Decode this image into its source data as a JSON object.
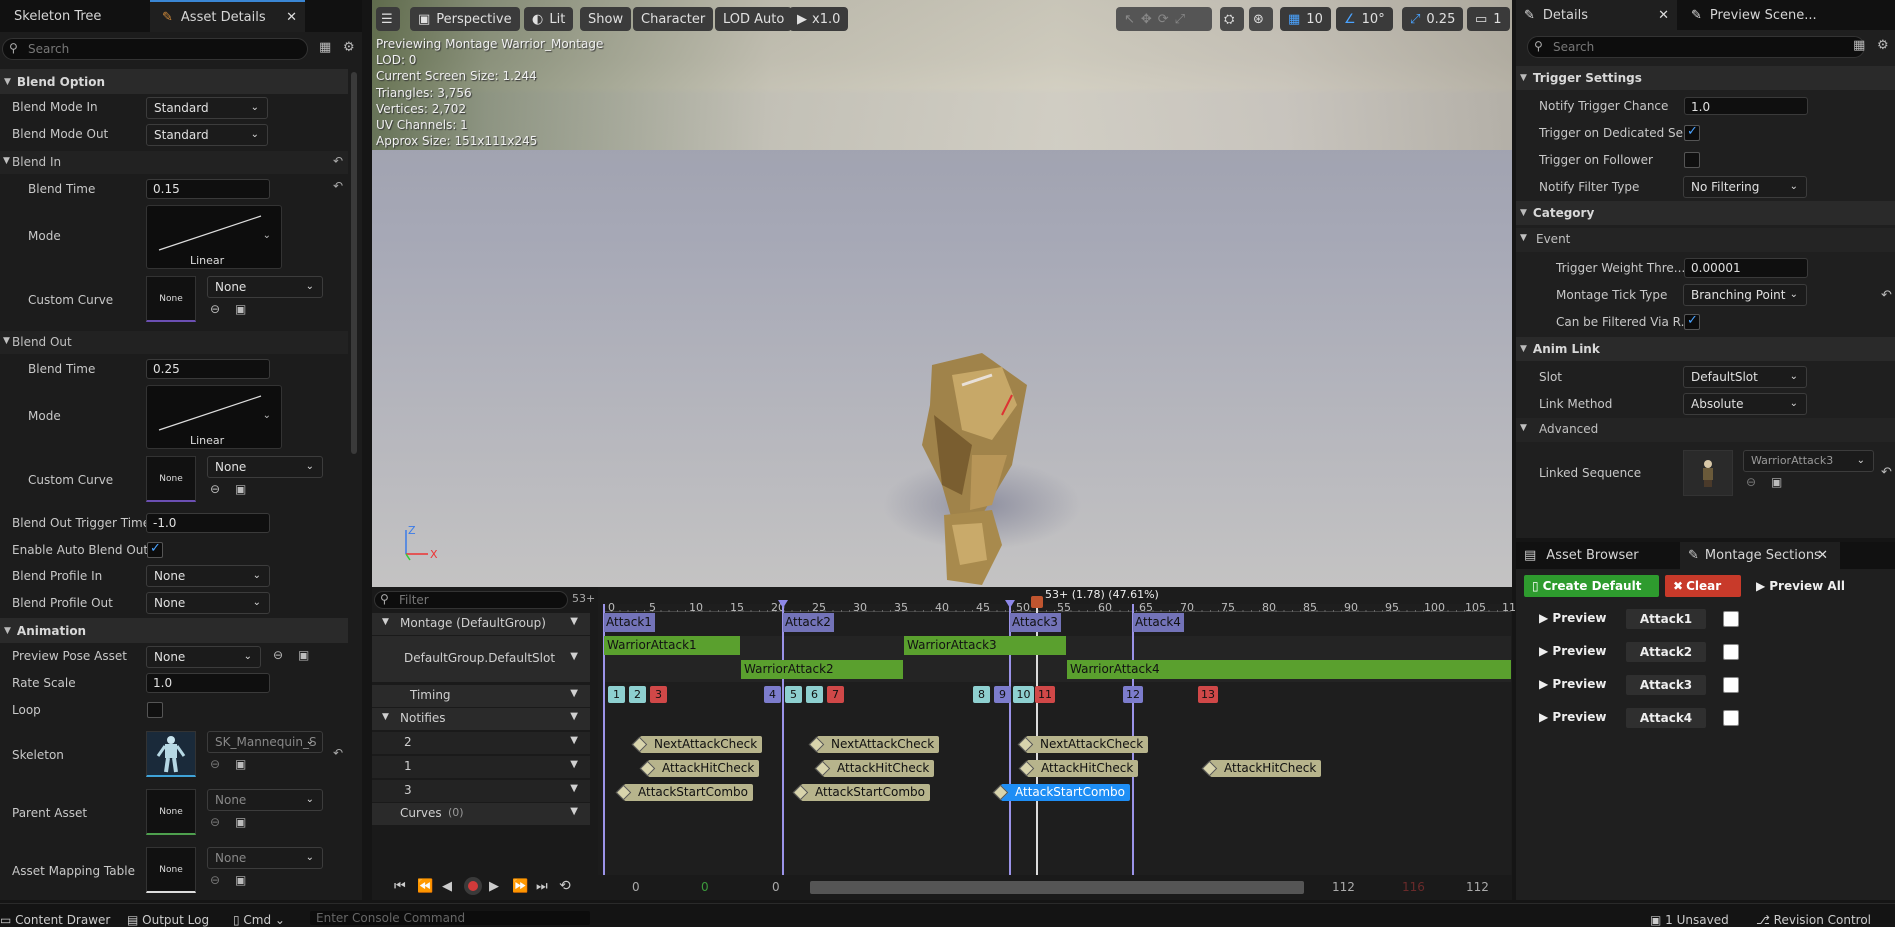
{
  "left_panel": {
    "tabs": {
      "skeleton_tree": "Skeleton Tree",
      "asset_details": "Asset Details"
    },
    "search_placeholder": "Search",
    "blend_option": {
      "title": "Blend Option",
      "blend_mode_in_label": "Blend Mode In",
      "blend_mode_in": "Standard",
      "blend_mode_out_label": "Blend Mode Out",
      "blend_mode_out": "Standard"
    },
    "blend_in": {
      "title": "Blend In",
      "blend_time_label": "Blend Time",
      "blend_time": "0.15",
      "mode_label": "Mode",
      "mode": "Linear",
      "custom_curve_label": "Custom Curve",
      "custom_curve": "None",
      "thumb_none": "None"
    },
    "blend_out": {
      "title": "Blend Out",
      "blend_time_label": "Blend Time",
      "blend_time": "0.25",
      "mode_label": "Mode",
      "mode": "Linear",
      "custom_curve_label": "Custom Curve",
      "custom_curve": "None",
      "thumb_none": "None"
    },
    "blend_out_trigger_time_label": "Blend Out Trigger Time",
    "blend_out_trigger_time": "-1.0",
    "enable_auto_blend_out_label": "Enable Auto Blend Out",
    "blend_profile_in_label": "Blend Profile In",
    "blend_profile_in": "None",
    "blend_profile_out_label": "Blend Profile Out",
    "blend_profile_out": "None",
    "animation": {
      "title": "Animation",
      "preview_pose_label": "Preview Pose Asset",
      "preview_pose": "None",
      "rate_scale_label": "Rate Scale",
      "rate_scale": "1.0",
      "loop_label": "Loop",
      "skeleton_label": "Skeleton",
      "skeleton": "SK_Mannequin_S",
      "parent_asset_label": "Parent Asset",
      "parent_asset": "None",
      "parent_thumb": "None",
      "mapping_label": "Asset Mapping Table",
      "mapping": "None",
      "mapping_thumb": "None"
    }
  },
  "viewport": {
    "toolbar": {
      "perspective": "Perspective",
      "lit": "Lit",
      "show": "Show",
      "character": "Character",
      "lod": "LOD Auto",
      "speed": "x1.0",
      "grid_value": "10",
      "angle_value": "10°",
      "scale_value": "0.25",
      "camera_speed": "1"
    },
    "info": [
      "Previewing Montage Warrior_Montage",
      "LOD: 0",
      "Current Screen Size: 1.244",
      "Triangles: 3,756",
      "Vertices: 2,702",
      "UV Channels: 1",
      "Approx Size: 151x111x245"
    ]
  },
  "timeline": {
    "filter_placeholder": "Filter",
    "filter_count": "53+",
    "playhead": "53+ (1.78) (47.61%)",
    "ticks": [
      "0",
      "5",
      "10",
      "15",
      "20",
      "25",
      "30",
      "35",
      "40",
      "45",
      "50",
      "55",
      "60",
      "65",
      "70",
      "75",
      "80",
      "85",
      "90",
      "95",
      "100",
      "105",
      "11"
    ],
    "tracks": {
      "montage": "Montage (DefaultGroup)",
      "slot": "DefaultGroup.DefaultSlot",
      "timing": "Timing",
      "notifies": "Notifies",
      "n2": "2",
      "n1": "1",
      "n3": "3",
      "curves": "Curves",
      "curves_count": "(0)"
    },
    "sections": [
      "Attack1",
      "Attack2",
      "Attack3",
      "Attack4"
    ],
    "segments": [
      "WarriorAttack1",
      "WarriorAttack2",
      "WarriorAttack3",
      "WarriorAttack4"
    ],
    "timing": [
      "1",
      "2",
      "3",
      "4",
      "5",
      "6",
      "7",
      "8",
      "9",
      "10",
      "11",
      "12",
      "13"
    ],
    "notifies": {
      "next": "NextAttackCheck",
      "hit": "AttackHitCheck",
      "start": "AttackStartCombo"
    },
    "transport": {
      "start": "0",
      "green": "0",
      "cur": "0",
      "end": "112",
      "red": "116",
      "total": "112"
    }
  },
  "details": {
    "tabs": {
      "details": "Details",
      "preview_scene": "Preview Scene..."
    },
    "search_placeholder": "Search",
    "trigger_settings": {
      "title": "Trigger Settings",
      "chance_label": "Notify Trigger Chance",
      "chance": "1.0",
      "dedicated_label": "Trigger on Dedicated Se...",
      "follower_label": "Trigger on Follower",
      "filter_type_label": "Notify Filter Type",
      "filter_type": "No Filtering"
    },
    "category": {
      "title": "Category",
      "event": "Event",
      "weight_label": "Trigger Weight Thre...",
      "weight": "0.00001",
      "tick_type_label": "Montage Tick Type",
      "tick_type": "Branching Point",
      "filtered_label": "Can be Filtered Via R..."
    },
    "anim_link": {
      "title": "Anim Link",
      "slot_label": "Slot",
      "slot": "DefaultSlot",
      "link_method_label": "Link Method",
      "link_method": "Absolute",
      "advanced": "Advanced",
      "linked_seq_label": "Linked Sequence",
      "linked_seq": "WarriorAttack3"
    }
  },
  "montage_sections": {
    "tabs": {
      "asset_browser": "Asset Browser",
      "montage_sections": "Montage Sections"
    },
    "create_default": "Create Default",
    "clear": "Clear",
    "preview_all": "Preview All",
    "rows": [
      {
        "preview": "Preview",
        "name": "Attack1"
      },
      {
        "preview": "Preview",
        "name": "Attack2"
      },
      {
        "preview": "Preview",
        "name": "Attack3"
      },
      {
        "preview": "Preview",
        "name": "Attack4"
      }
    ]
  },
  "status_bar": {
    "content_drawer": "Content Drawer",
    "output_log": "Output Log",
    "cmd": "Cmd",
    "console_placeholder": "Enter Console Command",
    "unsaved": "1 Unsaved",
    "revision": "Revision Control"
  }
}
